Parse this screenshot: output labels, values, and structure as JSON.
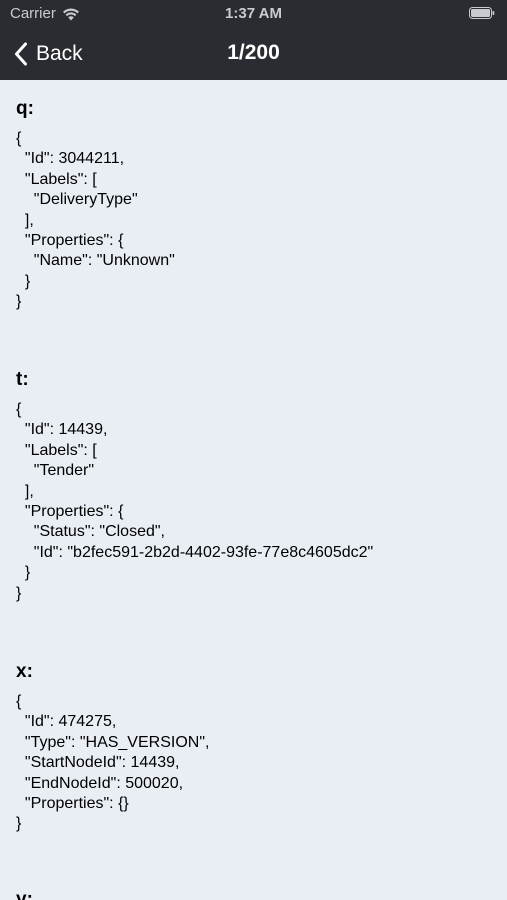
{
  "status_bar": {
    "carrier": "Carrier",
    "time": "1:37 AM",
    "icons": [
      "wifi-icon",
      "battery-icon"
    ]
  },
  "nav_bar": {
    "back_label": "Back",
    "title": "1/200",
    "back_icon": "chevron-left-icon"
  },
  "entries": [
    {
      "key": "q:",
      "body": "{\n  \"Id\": 3044211,\n  \"Labels\": [\n    \"DeliveryType\"\n  ],\n  \"Properties\": {\n    \"Name\": \"Unknown\"\n  }\n}"
    },
    {
      "key": "t:",
      "body": "{\n  \"Id\": 14439,\n  \"Labels\": [\n    \"Tender\"\n  ],\n  \"Properties\": {\n    \"Status\": \"Closed\",\n    \"Id\": \"b2fec591-2b2d-4402-93fe-77e8c4605dc2\"\n  }\n}"
    },
    {
      "key": "x:",
      "body": "{\n  \"Id\": 474275,\n  \"Type\": \"HAS_VERSION\",\n  \"StartNodeId\": 14439,\n  \"EndNodeId\": 500020,\n  \"Properties\": {}\n}"
    },
    {
      "key": "y:",
      "body": ""
    }
  ],
  "colors": {
    "bar_background": "#2a2c31",
    "content_background": "#e9eef5"
  }
}
